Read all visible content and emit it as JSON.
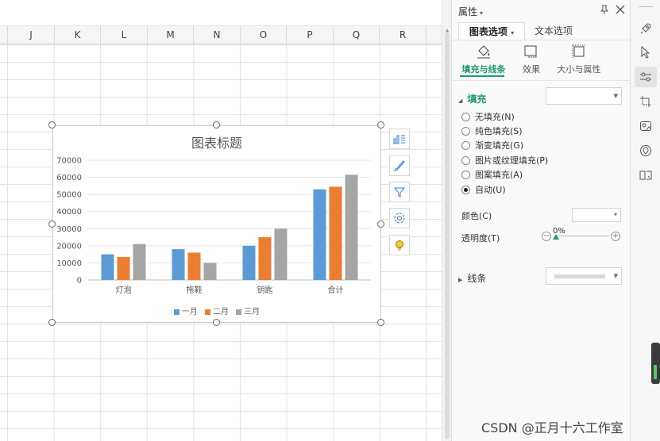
{
  "sheet": {
    "columns": [
      "J",
      "K",
      "L",
      "M",
      "N",
      "O",
      "P",
      "Q",
      "R"
    ]
  },
  "chart": {
    "title": "图表标题",
    "tools": [
      "chart-elements-icon",
      "chart-style-icon",
      "chart-filter-icon",
      "chart-settings-icon",
      "chart-tips-icon"
    ]
  },
  "chart_data": {
    "type": "bar",
    "title": "图表标题",
    "categories": [
      "灯泡",
      "拖鞋",
      "钥匙",
      "合计"
    ],
    "series": [
      {
        "name": "一月",
        "values": [
          15000,
          18000,
          20000,
          53000
        ],
        "color": "#5b9bd5"
      },
      {
        "name": "二月",
        "values": [
          13500,
          16000,
          25000,
          54500
        ],
        "color": "#ed7d31"
      },
      {
        "name": "三月",
        "values": [
          21000,
          10000,
          30000,
          61500
        ],
        "color": "#a5a5a5"
      }
    ],
    "y_ticks": [
      "70000",
      "60000",
      "50000",
      "40000",
      "30000",
      "20000",
      "10000",
      "0"
    ],
    "ylim": [
      0,
      70000
    ],
    "grid": true,
    "legend_position": "bottom"
  },
  "panel": {
    "title": "属性",
    "tabs": [
      {
        "label": "图表选项",
        "active": true
      },
      {
        "label": "文本选项",
        "active": false
      }
    ],
    "subtabs": [
      {
        "label": "填充与线条",
        "active": true
      },
      {
        "label": "效果",
        "active": false
      },
      {
        "label": "大小与属性",
        "active": false
      }
    ],
    "fill": {
      "label": "填充",
      "options": [
        {
          "label": "无填充(N)",
          "checked": false
        },
        {
          "label": "纯色填充(S)",
          "checked": false
        },
        {
          "label": "渐变填充(G)",
          "checked": false
        },
        {
          "label": "图片或纹理填充(P)",
          "checked": false
        },
        {
          "label": "图案填充(A)",
          "checked": false
        },
        {
          "label": "自动(U)",
          "checked": true
        }
      ],
      "color_label": "颜色(C)",
      "transparency_label": "透明度(T)",
      "transparency_value": "0%"
    },
    "line": {
      "label": "线条"
    }
  },
  "accent_color": "#1a9a6f",
  "watermark": "CSDN @正月十六工作室"
}
